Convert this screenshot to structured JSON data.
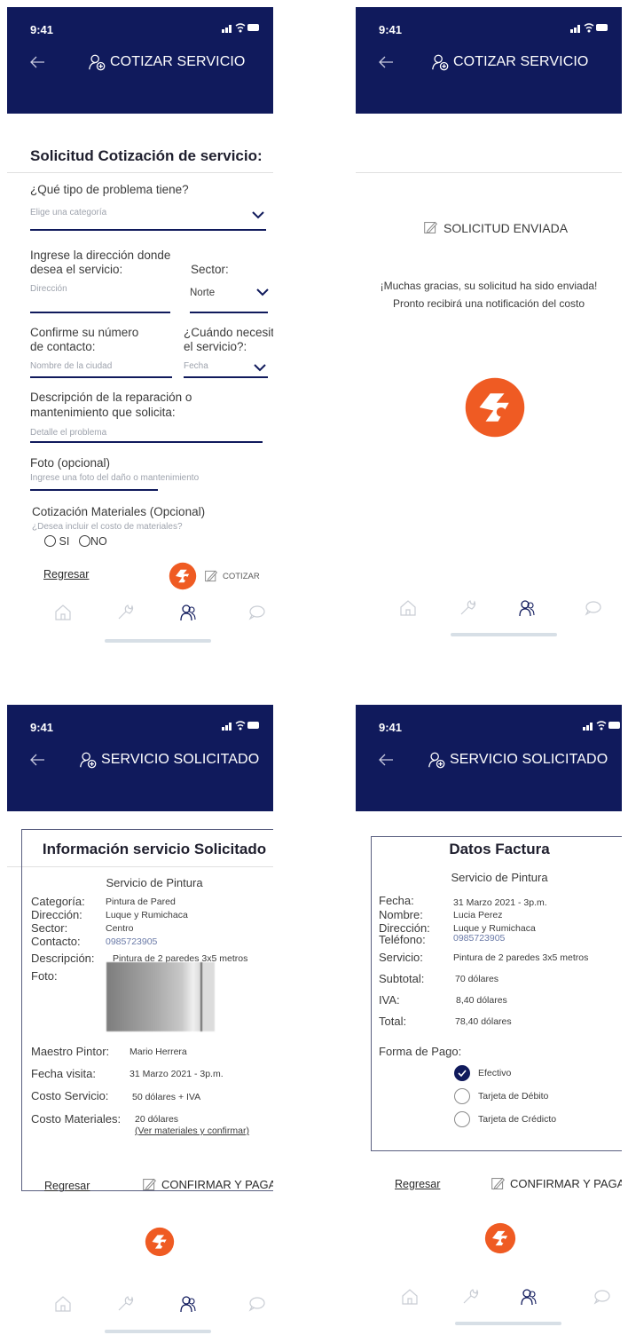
{
  "status": {
    "time": "9:41"
  },
  "screen1": {
    "title": "COTIZAR SERVICIO",
    "heading": "Solicitud Cotización de servicio:",
    "q_problem": "¿Qué tipo de problema tiene?",
    "category_placeholder": "Elige una categoría",
    "address_label_1": "Ingrese la dirección donde",
    "address_label_2": "desea el servicio:",
    "address_placeholder": "Dirección",
    "sector_label": "Sector:",
    "sector_value": "Norte",
    "contact_label_1": "Confirme su número",
    "contact_label_2": "de contacto:",
    "contact_placeholder": "Nombre de la ciudad",
    "when_label_1": "¿Cuándo necesita",
    "when_label_2": "el servicio?:",
    "date_placeholder": "Fecha",
    "desc_label_1": "Descripción de la reparación o",
    "desc_label_2": "mantenimiento que solicita:",
    "desc_placeholder": "Detalle el problema",
    "photo_label": "Foto (opcional)",
    "photo_placeholder": "Ingrese una foto del daño o mantenimiento",
    "materials_label": "Cotización Materiales (Opcional)",
    "materials_question": "¿Desea incluir el costo de materiales?",
    "opt_yes": "SI",
    "opt_no": "NO",
    "back_link": "Regresar",
    "quote_button": "COTIZAR"
  },
  "screen2": {
    "title": "COTIZAR SERVICIO",
    "sent_title": "SOLICITUD ENVIADA",
    "message_1": "¡Muchas gracias, su solicitud ha sido enviada!",
    "message_2": "Pronto recibirá una notificación del costo"
  },
  "screen3": {
    "title": "SERVICIO SOLICITADO",
    "card_title": "Información servicio Solicitado",
    "service_name": "Servicio de Pintura",
    "rows": [
      {
        "label": "Categoría:",
        "value": "Pintura de Pared"
      },
      {
        "label": "Dirección:",
        "value": "Luque  y Rumichaca"
      },
      {
        "label": "Sector:",
        "value": "Centro"
      },
      {
        "label": "Contacto:",
        "value": "0985723905"
      },
      {
        "label": "Descripción:",
        "value": "Pintura de 2 paredes 3x5 metros"
      },
      {
        "label": "Foto:",
        "value": ""
      }
    ],
    "master_label": "Maestro Pintor:",
    "master_value": "Mario Herrera",
    "visit_label": "Fecha visita:",
    "visit_value": "31 Marzo 2021 - 3p.m.",
    "cost_label": "Costo Servicio:",
    "cost_value": "50 dólares + IVA",
    "materials_label": "Costo Materiales:",
    "materials_value": "20 dólares",
    "materials_link": "(Ver materiales y confirmar)",
    "back_link": "Regresar",
    "confirm_button": "CONFIRMAR Y PAGAR"
  },
  "screen4": {
    "title": "SERVICIO SOLICITADO",
    "card_title": "Datos Factura",
    "service_name": "Servicio de Pintura",
    "rows": [
      {
        "label": "Fecha:",
        "value": "31 Marzo 2021 - 3p.m."
      },
      {
        "label": "Nombre:",
        "value": "Lucia Perez"
      },
      {
        "label": "Dirección:",
        "value": "Luque y Rumichaca"
      },
      {
        "label": "Teléfono:",
        "value": "0985723905"
      },
      {
        "label": "Servicio:",
        "value": "Pintura de 2 paredes 3x5 metros"
      },
      {
        "label": "Subtotal:",
        "value": "70 dólares"
      },
      {
        "label": "IVA:",
        "value": "8,40 dólares"
      },
      {
        "label": "Total:",
        "value": "78,40 dólares"
      }
    ],
    "payment_label": "Forma de Pago:",
    "payment_options": [
      "Efectivo",
      "Tarjeta de Débito",
      "Tarjeta de Crédicto"
    ],
    "back_link": "Regresar",
    "confirm_button": "CONFIRMAR Y PAGAR"
  },
  "nav": {
    "items": [
      "home-icon",
      "wrench-icon",
      "people-icon",
      "chat-icon"
    ]
  },
  "colors": {
    "primary": "#101a5c",
    "accent": "#ef5b23"
  }
}
